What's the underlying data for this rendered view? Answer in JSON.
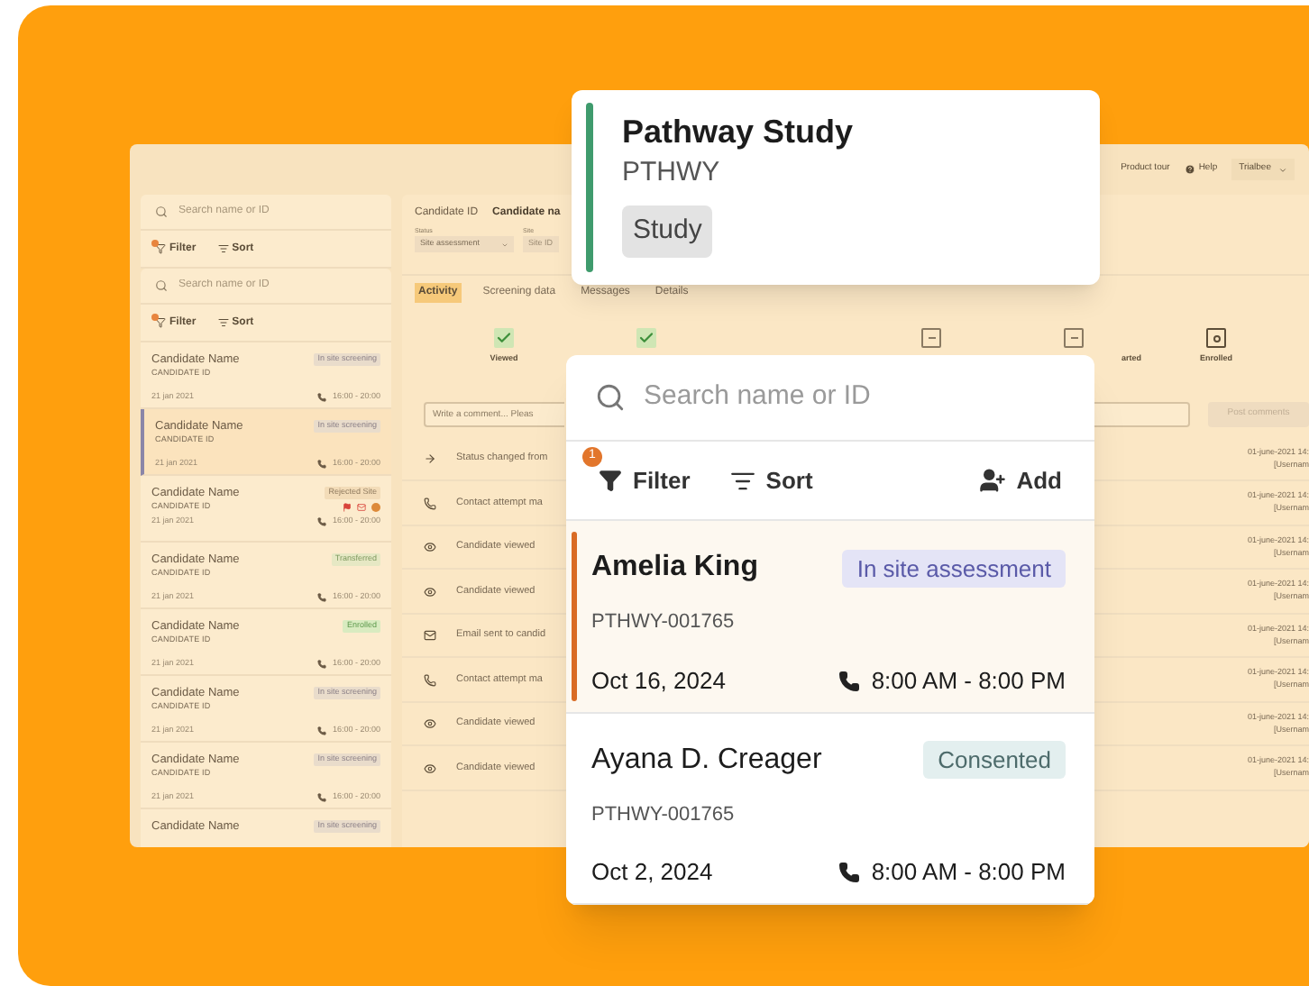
{
  "background_app": {
    "top_bar": {
      "tour": "Product tour",
      "help": "Help",
      "account": "Trialbee"
    },
    "left_panels": [
      {
        "placeholder": "Search name or ID",
        "filter": "Filter",
        "sort": "Sort",
        "filter_active": true
      },
      {
        "placeholder": "Search name or ID",
        "filter": "Filter",
        "sort": "Sort",
        "filter_active": true
      }
    ],
    "candidates": [
      {
        "name": "Candidate Name",
        "id": "CANDIDATE ID",
        "date": "21 jan 2021",
        "time": "16:00 - 20:00",
        "status": "In site screening",
        "kind": "screening",
        "selected": false,
        "flags": false
      },
      {
        "name": "Candidate Name",
        "id": "CANDIDATE ID",
        "date": "21 jan 2021",
        "time": "16:00 - 20:00",
        "status": "In site screening",
        "kind": "screening",
        "selected": true,
        "flags": false
      },
      {
        "name": "Candidate Name",
        "id": "CANDIDATE ID",
        "date": "21 jan 2021",
        "time": "16:00 - 20:00",
        "status": "Rejected Site",
        "kind": "rejected",
        "selected": false,
        "flags": true
      },
      {
        "name": "Candidate Name",
        "id": "CANDIDATE ID",
        "date": "21 jan 2021",
        "time": "16:00 - 20:00",
        "status": "Transferred",
        "kind": "success",
        "selected": false,
        "flags": false
      },
      {
        "name": "Candidate Name",
        "id": "CANDIDATE ID",
        "date": "21 jan 2021",
        "time": "16:00 - 20:00",
        "status": "Enrolled",
        "kind": "enrolled",
        "selected": false,
        "flags": false
      },
      {
        "name": "Candidate Name",
        "id": "CANDIDATE ID",
        "date": "21 jan 2021",
        "time": "16:00 - 20:00",
        "status": "In site screening",
        "kind": "screening",
        "selected": false,
        "flags": false
      },
      {
        "name": "Candidate Name",
        "id": "CANDIDATE ID",
        "date": "21 jan 2021",
        "time": "16:00 - 20:00",
        "status": "In site screening",
        "kind": "screening",
        "selected": false,
        "flags": false
      },
      {
        "name": "Candidate Name",
        "status": "In site screening",
        "kind": "screening",
        "selected": false,
        "flags": false
      }
    ],
    "header": {
      "id_label": "Candidate ID",
      "name": "Candidate na",
      "status_label": "Status",
      "status_value": "Site assessment",
      "site_label": "Site",
      "site_value": "Site ID"
    },
    "tabs": [
      {
        "label": "Activity",
        "selected": true
      },
      {
        "label": "Screening data",
        "selected": false
      },
      {
        "label": "Messages",
        "selected": false
      },
      {
        "label": "Details",
        "selected": false
      }
    ],
    "steps": [
      {
        "kind": "done",
        "label": "Viewed"
      },
      {
        "kind": "done"
      },
      {
        "kind": "blank"
      },
      {
        "kind": "pending"
      },
      {
        "kind": "pending",
        "label": "arted"
      },
      {
        "kind": "enrolled",
        "label": "Enrolled"
      }
    ],
    "comment": {
      "placeholder": "Write a comment... Pleas",
      "button": "Post comments"
    },
    "activity": [
      {
        "kind": "arrow",
        "text": "Status changed from",
        "time": "01-june-2021 14:",
        "user": "[Usernam"
      },
      {
        "kind": "phone",
        "text": "Contact attempt ma",
        "time": "01-june-2021 14:",
        "user": "[Usernam"
      },
      {
        "kind": "eye",
        "text": "Candidate viewed",
        "time": "01-june-2021 14:",
        "user": "[Usernam"
      },
      {
        "kind": "eye",
        "text": "Candidate viewed",
        "time": "01-june-2021 14:",
        "user": "[Usernam"
      },
      {
        "kind": "mail",
        "text": "Email sent to candid",
        "time": "01-june-2021 14:",
        "user": "[Usernam"
      },
      {
        "kind": "phone",
        "text": "Contact attempt ma",
        "time": "01-june-2021 14:",
        "user": "[Usernam"
      },
      {
        "kind": "eye",
        "text": "Candidate viewed",
        "time": "01-june-2021 14:",
        "user": "[Usernam"
      },
      {
        "kind": "eye",
        "text": "Candidate viewed",
        "time": "01-june-2021 14:",
        "user": "[Usernam"
      }
    ]
  },
  "study_card": {
    "title": "Pathway Study",
    "code": "PTHWY",
    "tag": "Study"
  },
  "search_card": {
    "placeholder": "Search name or ID",
    "filter": "Filter",
    "filter_count": "1",
    "sort": "Sort",
    "add": "Add",
    "candidates": [
      {
        "name": "Amelia King",
        "id": "PTHWY-001765",
        "date": "Oct 16, 2024",
        "hours": "8:00 AM - 8:00 PM",
        "status": "In site assessment",
        "kind": "assessment",
        "selected": true
      },
      {
        "name": "Ayana D. Creager",
        "id": "PTHWY-001765",
        "date": "Oct 2, 2024",
        "hours": "8:00 AM - 8:00 PM",
        "status": "Consented",
        "kind": "consented",
        "selected": false
      }
    ]
  }
}
